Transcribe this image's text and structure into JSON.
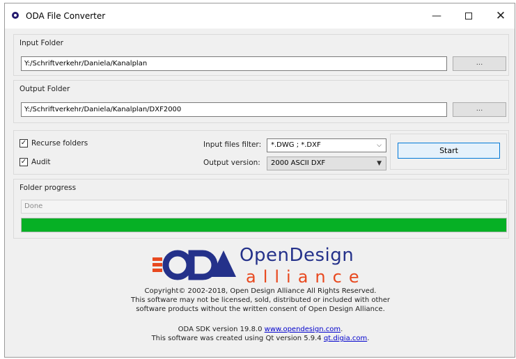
{
  "window": {
    "title": "ODA File Converter",
    "minimize_glyph": "—",
    "close_glyph": "✕"
  },
  "input_folder": {
    "label": "Input Folder",
    "value": "Y:/Schriftverkehr/Daniela/Kanalplan",
    "browse_label": "..."
  },
  "output_folder": {
    "label": "Output Folder",
    "value": "Y:/Schriftverkehr/Daniela/Kanalplan/DXF2000",
    "browse_label": "..."
  },
  "options": {
    "recurse_label": "Recurse folders",
    "recurse_checked": true,
    "audit_label": "Audit",
    "audit_checked": true,
    "check_glyph": "✓"
  },
  "filters": {
    "input_filter_label": "Input files filter:",
    "input_filter_value": "*.DWG ; *.DXF",
    "output_version_label": "Output version:",
    "output_version_value": "2000 ASCII DXF",
    "dropdown_glyph_light": "⌵",
    "dropdown_glyph_dark": "▼"
  },
  "actions": {
    "start_label": "Start"
  },
  "progress": {
    "label": "Folder progress",
    "status": "Done",
    "value": 1.0,
    "fill_color": "#06b025"
  },
  "branding": {
    "logo_primary": "OpenDesign",
    "logo_secondary": "alliance",
    "colors": {
      "navy": "#24318a",
      "orange": "#e8491f"
    },
    "copyright": "Copyright© 2002-2018, Open Design Alliance All Rights Reserved.",
    "license_line1": "This software may not be licensed, sold, distributed or included with other",
    "license_line2": "software products without the written consent of Open Design Alliance.",
    "sdk_prefix": "ODA SDK version 19.8.0",
    "sdk_link": "www.opendesign.com",
    "qt_prefix": "This software was created using Qt version 5.9.4",
    "qt_link": "qt.digia.com"
  }
}
